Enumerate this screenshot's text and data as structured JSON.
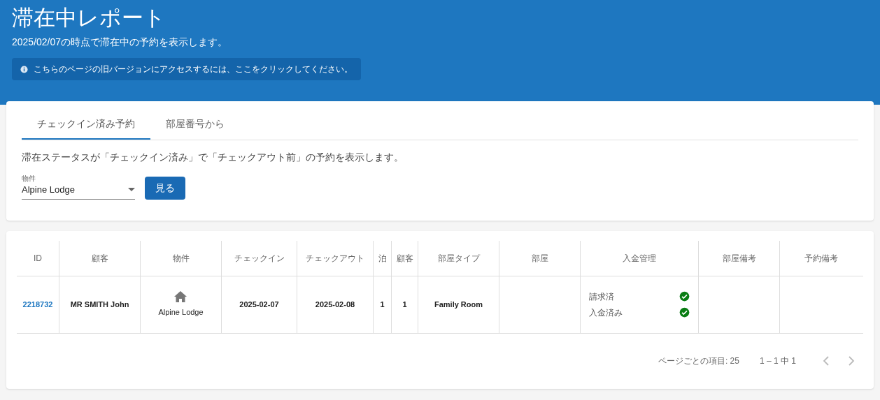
{
  "header": {
    "title": "滞在中レポート",
    "subtitle": "2025/02/07の時点で滞在中の予約を表示します。",
    "notice": "こちらのページの旧バージョンにアクセスするには、ここをクリックしてください。"
  },
  "tabs": [
    {
      "label": "チェックイン済み予約",
      "selected": true
    },
    {
      "label": "部屋番号から",
      "selected": false
    }
  ],
  "description": "滞在ステータスが「チェックイン済み」で「チェックアウト前」の予約を表示します。",
  "property_select": {
    "label": "物件",
    "value": "Alpine Lodge"
  },
  "view_button": "見る",
  "table": {
    "columns": [
      "ID",
      "顧客",
      "物件",
      "チェックイン",
      "チェックアウト",
      "泊",
      "顧客",
      "部屋タイプ",
      "部屋",
      "入金管理",
      "部屋備考",
      "予約備考"
    ],
    "rows": [
      {
        "id": "2218732",
        "customer": "MR SMITH John",
        "property": "Alpine Lodge",
        "checkin": "2025-02-07",
        "checkout": "2025-02-08",
        "nights": "1",
        "guests": "1",
        "room_type": "Family Room",
        "payments": [
          {
            "label": "請求済",
            "checked": true
          },
          {
            "label": "入金済み",
            "checked": true
          }
        ]
      }
    ]
  },
  "pagination": {
    "per_page": "ページごとの項目: 25",
    "range": "1 – 1 中 1",
    "prev_disabled": true,
    "next_disabled": true
  }
}
